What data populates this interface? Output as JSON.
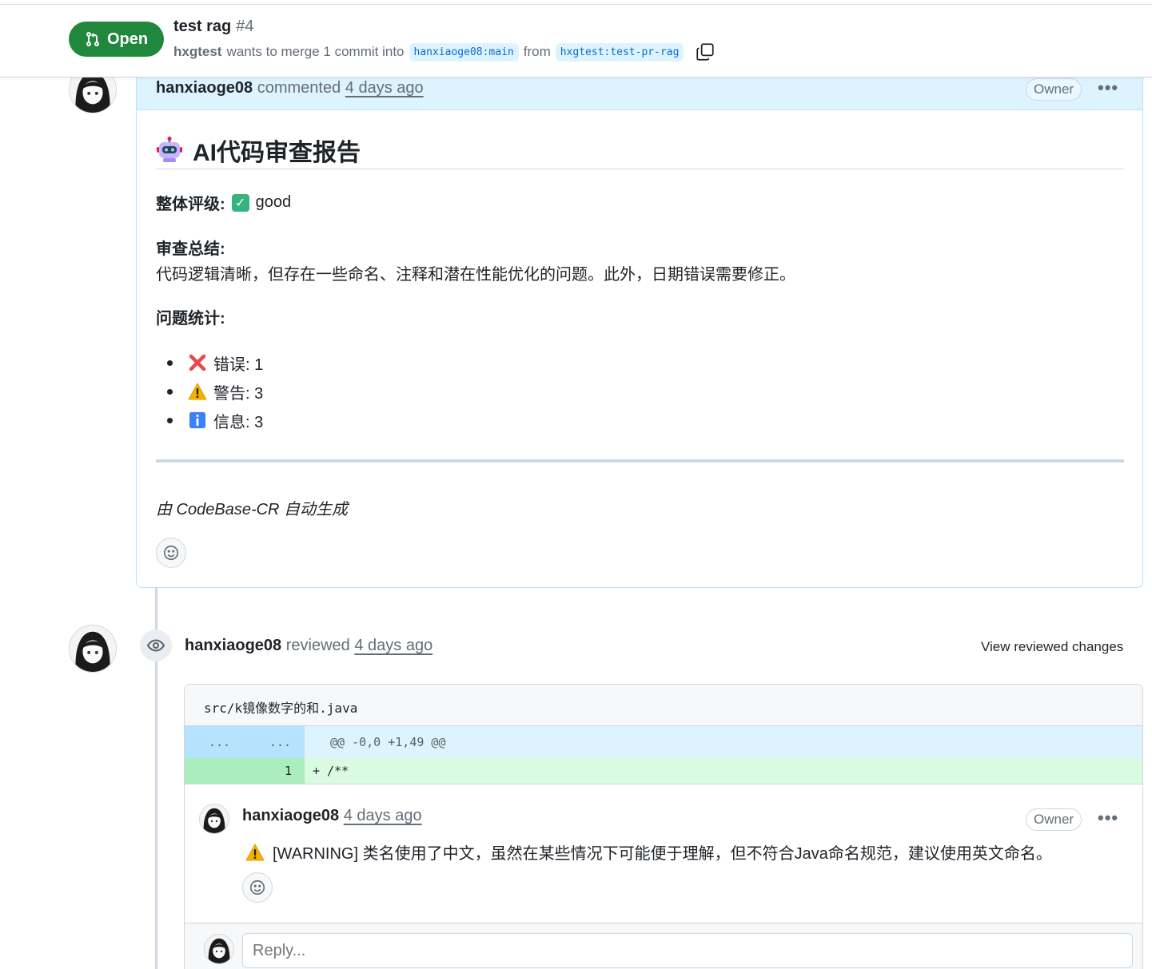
{
  "pr": {
    "state": "Open",
    "title": "test rag",
    "number": "#4",
    "author": "hxgtest",
    "merge_text": "wants to merge 1 commit into",
    "base_branch": "hanxiaoge08:main",
    "from_text": "from",
    "head_branch": "hxgtest:test-pr-rag"
  },
  "comment": {
    "author": "hanxiaoge08",
    "action": "commented",
    "timestamp": "4 days ago",
    "badge": "Owner",
    "menu": "•••",
    "title": "AI代码审查报告",
    "rating_label": "整体评级:",
    "rating_value": "good",
    "summary_label": "审查总结:",
    "summary_text": "代码逻辑清晰，但存在一些命名、注释和潜在性能优化的问题。此外，日期错误需要修正。",
    "stats_label": "问题统计:",
    "stats": [
      {
        "icon": "cross-mark-icon",
        "label": "错误: 1"
      },
      {
        "icon": "warning-icon",
        "label": "警告: 3"
      },
      {
        "icon": "info-icon",
        "label": "信息: 3"
      }
    ],
    "footer": "由 CodeBase-CR 自动生成"
  },
  "review": {
    "author": "hanxiaoge08",
    "action": "reviewed",
    "timestamp": "4 days ago",
    "view_changes": "View reviewed changes",
    "file": "src/k镜像数字的和.java",
    "hunk_left": "...",
    "hunk_right": "...",
    "hunk_header": "@@ -0,0 +1,49 @@",
    "line_number": "1",
    "line_code": "+ /**",
    "thread": {
      "author": "hanxiaoge08",
      "timestamp": "4 days ago",
      "badge": "Owner",
      "menu": "•••",
      "message": "[WARNING] 类名使用了中文，虽然在某些情况下可能便于理解，但不符合Java命名规范，建议使用英文命名。"
    },
    "reply_placeholder": "Reply..."
  },
  "colors": {
    "open_green": "#1f883d",
    "header_blue": "#ddf4ff",
    "branch_blue": "#0969da",
    "add_green": "#dafbe1"
  }
}
